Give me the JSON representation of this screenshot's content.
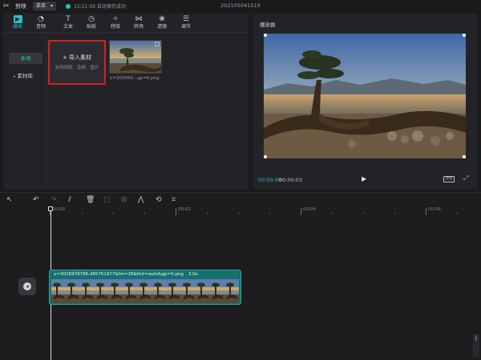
{
  "titlebar": {
    "app_name": "剪映",
    "menu_label": "菜单",
    "save_status": "15:21:59 自动保存成功",
    "project_title": "202105041519"
  },
  "media_toolbar": [
    {
      "label": "媒体",
      "icon": "media-icon",
      "active": true
    },
    {
      "label": "音频",
      "icon": "audio-icon"
    },
    {
      "label": "文本",
      "icon": "text-icon"
    },
    {
      "label": "贴纸",
      "icon": "sticker-icon"
    },
    {
      "label": "特效",
      "icon": "effects-icon"
    },
    {
      "label": "转场",
      "icon": "transition-icon"
    },
    {
      "label": "滤镜",
      "icon": "filter-icon"
    },
    {
      "label": "调节",
      "icon": "adjust-icon"
    }
  ],
  "sidebar": {
    "items": [
      {
        "label": "本地",
        "active": true
      },
      {
        "label": "素材库"
      }
    ]
  },
  "import_card": {
    "title": "导入素材",
    "subtitle": "支持视频、音频、图片"
  },
  "media_item": {
    "filename": "u=302693...gp=0.png"
  },
  "player": {
    "title": "播放器",
    "current_time": "00:00:00",
    "total_time": "00:00:03",
    "ratio_label": "原始"
  },
  "timeline": {
    "ticks": [
      "00:00",
      "00:02",
      "00:04",
      "00:06"
    ],
    "clip": {
      "name": "u=3026978796,485761977&fm=26&fmt=auto&gp=0.png",
      "duration": "3.0s"
    }
  },
  "colors": {
    "accent": "#29c0c8",
    "import_border": "#d02222",
    "clip_bg": "#16706f"
  }
}
